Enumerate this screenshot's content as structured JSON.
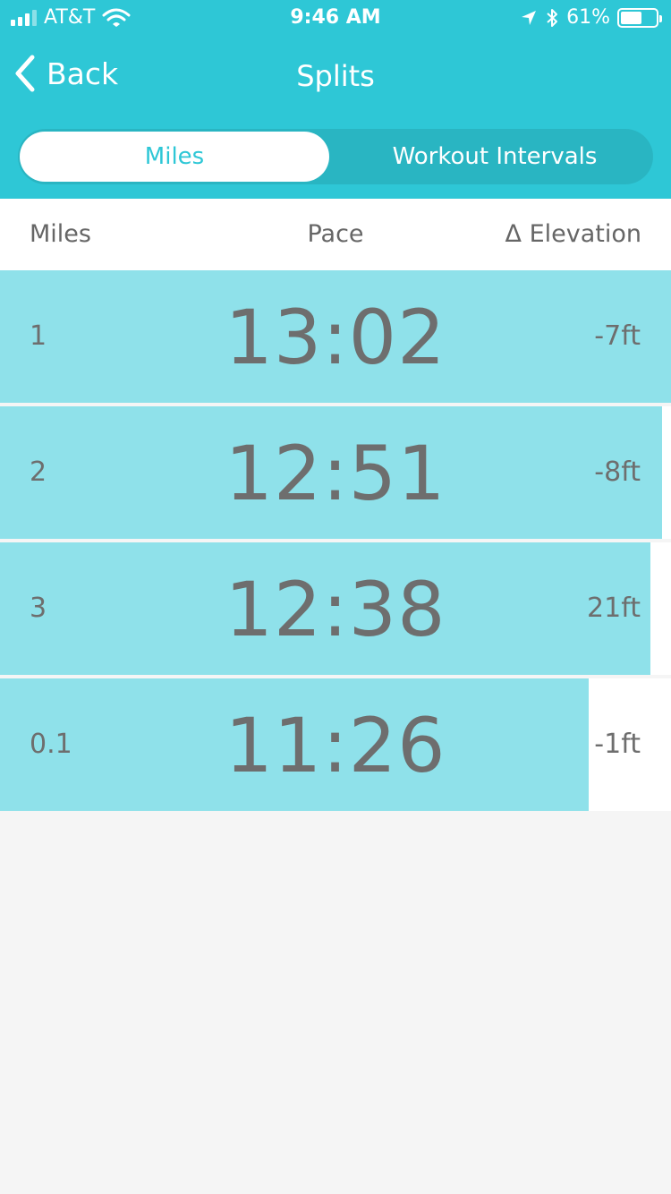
{
  "colors": {
    "accent": "#2ec7d6",
    "bar": "#8fe1ea"
  },
  "status_bar": {
    "carrier": "AT&T",
    "time": "9:46 AM",
    "battery_percent": "61%",
    "battery_level": 0.61,
    "icons": [
      "signal-icon",
      "wifi-icon",
      "location-icon",
      "bluetooth-icon",
      "battery-icon"
    ]
  },
  "nav": {
    "back_label": "Back",
    "title": "Splits"
  },
  "segments": {
    "active": "Miles",
    "inactive": "Workout Intervals"
  },
  "table": {
    "headers": {
      "miles": "Miles",
      "pace": "Pace",
      "elevation": "Δ Elevation"
    },
    "rows": [
      {
        "mile": "1",
        "pace": "13:02",
        "elevation": "-7ft",
        "bar_fraction": 1.0
      },
      {
        "mile": "2",
        "pace": "12:51",
        "elevation": "-8ft",
        "bar_fraction": 0.987
      },
      {
        "mile": "3",
        "pace": "12:38",
        "elevation": "21ft",
        "bar_fraction": 0.969
      },
      {
        "mile": "0.1",
        "pace": "11:26",
        "elevation": "-1ft",
        "bar_fraction": 0.877
      }
    ]
  }
}
